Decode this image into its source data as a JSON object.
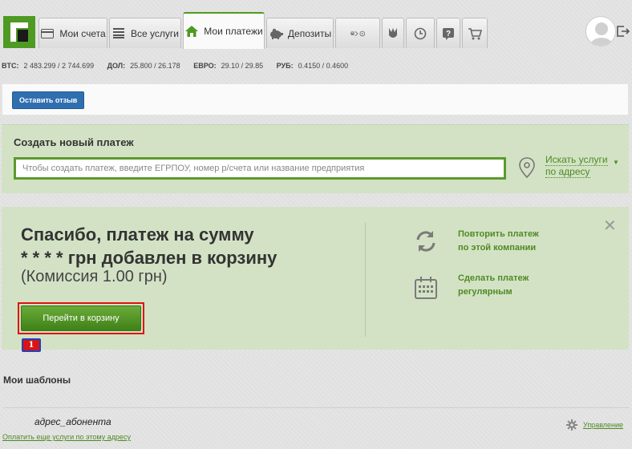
{
  "nav": {
    "tabs": [
      {
        "label": "Мои счета",
        "icon": "card-icon"
      },
      {
        "label": "Все услуги",
        "icon": "list-icon"
      },
      {
        "label": "Мои платежи",
        "icon": "home-icon"
      },
      {
        "label": "Депозиты",
        "icon": "piggy-bank-icon"
      }
    ],
    "icon_tabs": [
      "transport-icon",
      "trident-icon",
      "history-icon",
      "help-icon",
      "cart-icon"
    ]
  },
  "rates": [
    {
      "label": "BTC:",
      "value": "2 483.299 / 2 744.699"
    },
    {
      "label": "ДОЛ:",
      "value": "25.800 / 26.178"
    },
    {
      "label": "ЕВРО:",
      "value": "29.10 / 29.85"
    },
    {
      "label": "РУБ:",
      "value": "0.4150 / 0.4600"
    }
  ],
  "feedback": {
    "button_label": "Оставить отзыв"
  },
  "create": {
    "title": "Создать новый платеж",
    "placeholder": "Чтобы создать платеж, введите ЕГРПОУ, номер р/счета или название предприятия",
    "search_link_line1": "Искать услуги",
    "search_link_line2": "по адресу"
  },
  "confirm": {
    "line1": "Спасибо,  платеж на сумму",
    "line2": "* * * * грн  добавлен в корзину",
    "commission": "(Комиссия 1.00 грн)",
    "cart_button": "Перейти в корзину",
    "badge": "1",
    "close": "✕",
    "repeat_line1": "Повторить платеж",
    "repeat_line2": "по этой компании",
    "regular_line1": "Сделать платеж",
    "regular_line2": "регулярным"
  },
  "templates": {
    "title": "Мои шаблоны",
    "item_name": "адрес_абонента",
    "pay_link": "Оплатить еще услуги по этому адресу",
    "manage_link": "Управление"
  },
  "colors": {
    "brand_green": "#4e9a23",
    "panel_green": "#d3e2c5",
    "accent_blue": "#2f6fb0",
    "highlight_red": "#e01010"
  }
}
